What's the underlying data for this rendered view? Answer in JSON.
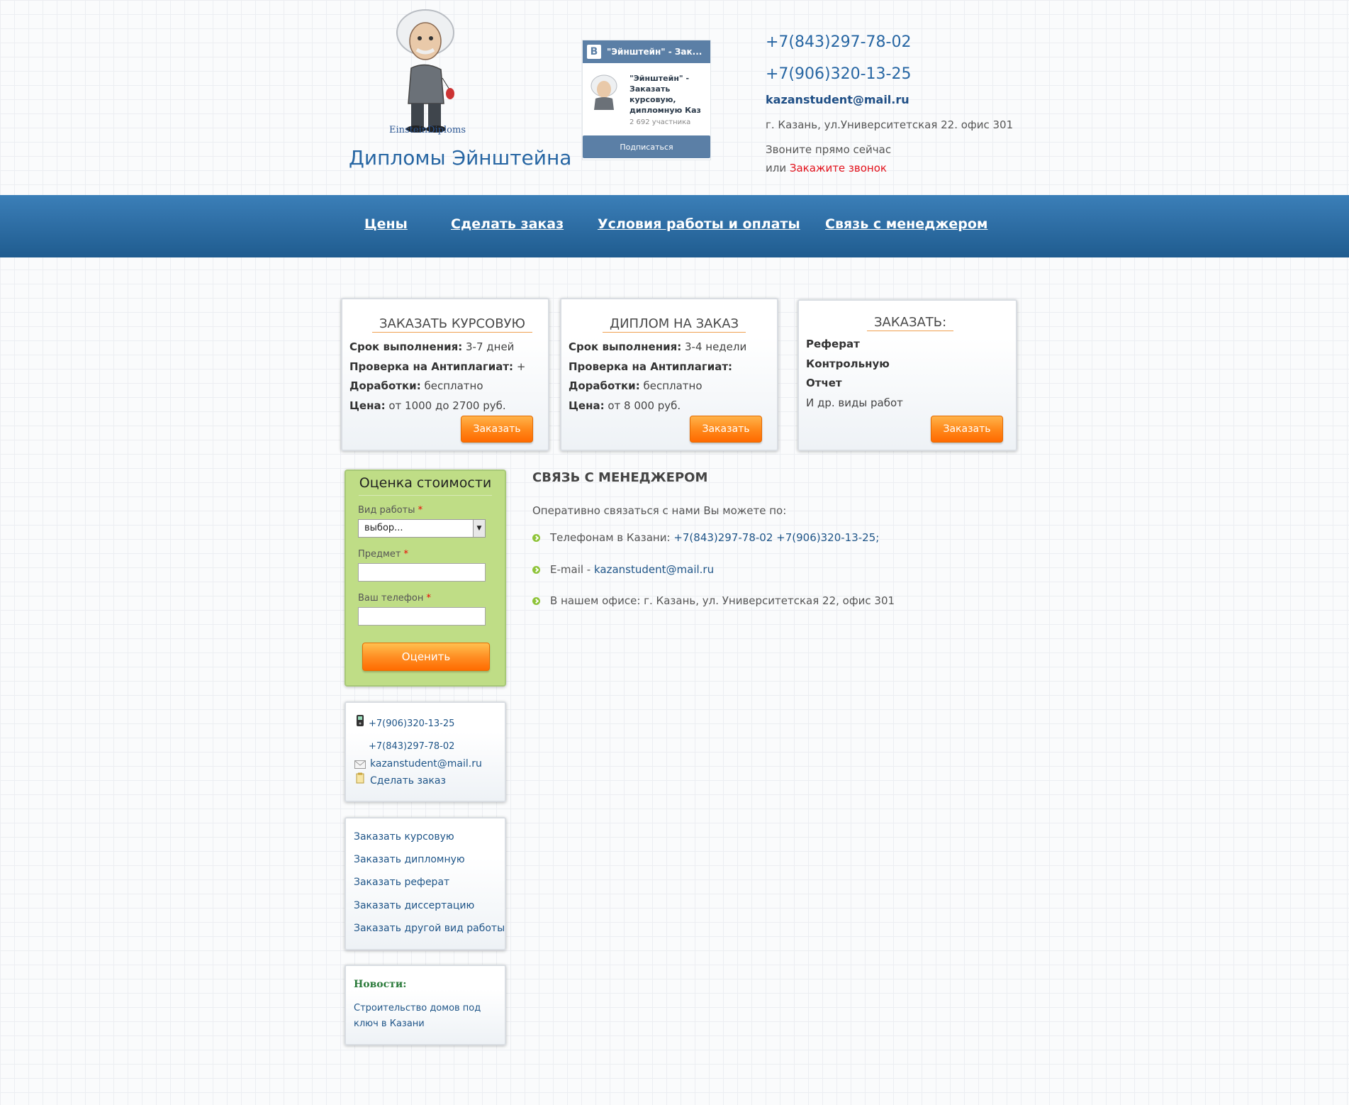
{
  "header": {
    "logo_caption": "EinsteinDiploms",
    "site_title": "Дипломы Эйнштейна",
    "vk_widget": {
      "head_title": "\"Эйнштейн\" - Зак...",
      "group_text": "\"Эйнштейн\" - Заказать курсовую, дипломную Каз",
      "members": "2 692 участника",
      "subscribe_label": "Подписаться"
    },
    "phone1": "+7(843)297-78-02",
    "phone2": "+7(906)320-13-25",
    "email": "kazanstudent@mail.ru",
    "address": "г. Казань, ул.Университетская 22. офис 301",
    "call_now": "Звоните прямо сейчас",
    "call_or": "или",
    "call_link": "Закажите звонок"
  },
  "nav": {
    "items": [
      "Цены",
      "Сделать заказ",
      "Условия работы и оплаты",
      "Связь с менеджером"
    ]
  },
  "offers": [
    {
      "title": "ЗАКАЗАТЬ КУРСОВУЮ",
      "rows": [
        {
          "label": "Срок выполнения:",
          "value": "3-7 дней"
        },
        {
          "label": "Проверка на Антиплагиат:",
          "value": "+"
        },
        {
          "label": "Доработки:",
          "value": "бесплатно"
        },
        {
          "label": "Цена:",
          "value": "от 1000 до 2700 руб."
        }
      ],
      "button": "Заказать"
    },
    {
      "title": "ДИПЛОМ НА ЗАКАЗ",
      "rows": [
        {
          "label": "Срок выполнения:",
          "value": "3-4 недели"
        },
        {
          "label": "Проверка на Антиплагиат:",
          "value": ""
        },
        {
          "label": "Доработки:",
          "value": "бесплатно"
        },
        {
          "label": "Цена:",
          "value": "от 8 000 руб."
        }
      ],
      "button": "Заказать"
    },
    {
      "title": "ЗАКАЗАТЬ:",
      "items": [
        "Реферат",
        "Контрольную",
        "Отчет",
        "И др. виды работ"
      ],
      "button": "Заказать"
    }
  ],
  "estimate": {
    "title": "Оценка стоимости",
    "work_type_label": "Вид работы",
    "work_type_value": "выбор...",
    "subject_label": "Предмет",
    "phone_label": "Ваш телефон",
    "required_mark": "*",
    "submit_label": "Оценить"
  },
  "contacts_box": {
    "phone1": "+7(906)320-13-25",
    "phone2": "+7(843)297-78-02",
    "email": "kazanstudent@mail.ru",
    "order_link": "Сделать заказ"
  },
  "links_box": {
    "items": [
      "Заказать курсовую",
      "Заказать дипломную",
      "Заказать реферат",
      "Заказать диссертацию",
      "Заказать другой вид работы"
    ]
  },
  "news_box": {
    "title": "Новости:",
    "item_line1": "Строительство домов под",
    "item_line2": "ключ в Казани"
  },
  "manager": {
    "title": "СВЯЗЬ С МЕНЕДЖЕРОМ",
    "intro": "Оперативно связаться с нами Вы можете по:",
    "phones_label": "Телефонам в Казани:",
    "phone1": "+7(843)297-78-02",
    "phone2": "+7(906)320-13-25;",
    "email_label": "E-mail -",
    "email": "kazanstudent@mail.ru",
    "office": "В нашем офисе: г. Казань, ул. Университетская 22, офис 301"
  },
  "colors": {
    "brand_blue": "#2766a3",
    "nav_blue": "#2f6fa6",
    "order_orange": "#ff8a1c",
    "estimate_green": "#bfdd86",
    "call_red": "#e3111b"
  }
}
